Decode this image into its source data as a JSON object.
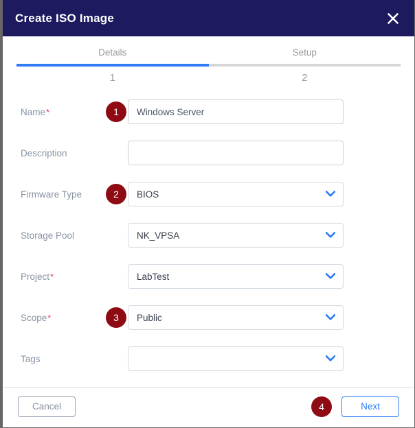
{
  "dialog": {
    "title": "Create ISO Image",
    "close_icon": "close-icon"
  },
  "stepper": {
    "steps": [
      {
        "label": "Details",
        "number": "1",
        "active": true
      },
      {
        "label": "Setup",
        "number": "2",
        "active": false
      }
    ]
  },
  "form": {
    "fields": [
      {
        "label": "Name",
        "required": "*",
        "badge": "1",
        "type": "text",
        "value": "Windows Server",
        "placeholder": ""
      },
      {
        "label": "Description",
        "required": "",
        "badge": "",
        "type": "text",
        "value": "",
        "placeholder": ""
      },
      {
        "label": "Firmware Type",
        "required": "",
        "badge": "2",
        "type": "select",
        "value": "BIOS",
        "placeholder": ""
      },
      {
        "label": "Storage Pool",
        "required": "",
        "badge": "",
        "type": "select",
        "value": "NK_VPSA",
        "placeholder": ""
      },
      {
        "label": "Project",
        "required": "*",
        "badge": "",
        "type": "select",
        "value": "LabTest",
        "placeholder": ""
      },
      {
        "label": "Scope",
        "required": "*",
        "badge": "3",
        "type": "select",
        "value": "Public",
        "placeholder": ""
      },
      {
        "label": "Tags",
        "required": "",
        "badge": "",
        "type": "select",
        "value": "",
        "placeholder": ""
      }
    ]
  },
  "footer": {
    "cancel_label": "Cancel",
    "next_label": "Next",
    "next_badge": "4"
  },
  "colors": {
    "header_bg": "#1d1a60",
    "accent_blue": "#2f7cf6",
    "badge_red": "#8e0b14",
    "required_red": "#e8384f",
    "label_gray": "#8794a3",
    "step_inactive": "#d6d6d6"
  }
}
